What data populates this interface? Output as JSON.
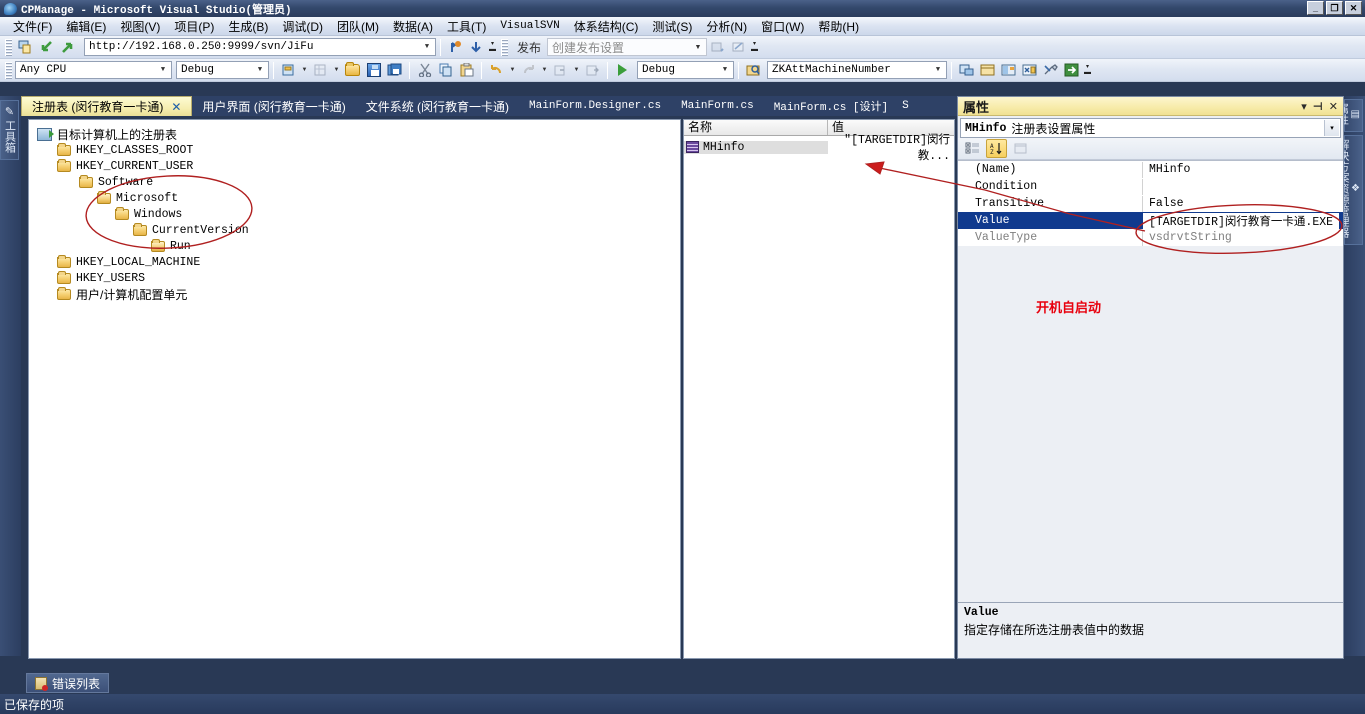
{
  "window": {
    "title": "CPManage - Microsoft Visual Studio(管理员)",
    "minimize": "_",
    "restore": "❐",
    "close": "✕"
  },
  "menu": {
    "items": [
      {
        "label": "文件(F)"
      },
      {
        "label": "编辑(E)"
      },
      {
        "label": "视图(V)"
      },
      {
        "label": "项目(P)"
      },
      {
        "label": "生成(B)"
      },
      {
        "label": "调试(D)"
      },
      {
        "label": "团队(M)"
      },
      {
        "label": "数据(A)"
      },
      {
        "label": "工具(T)"
      },
      {
        "label": "VisualSVN"
      },
      {
        "label": "体系结构(C)"
      },
      {
        "label": "测试(S)"
      },
      {
        "label": "分析(N)"
      },
      {
        "label": "窗口(W)"
      },
      {
        "label": "帮助(H)"
      }
    ]
  },
  "toolbar_svn": {
    "url_value": "http://192.168.0.250:9999/svn/JiFu",
    "publish_label": "发布",
    "publish_combo_placeholder": "创建发布设置"
  },
  "toolbar_standard": {
    "platform_value": "Any CPU",
    "config_value": "Debug",
    "debug_target_value": "Debug",
    "find_combo_value": "ZKAttMachineNumber"
  },
  "tabs": [
    {
      "label": "注册表 (闵行教育一卡通)",
      "active": true,
      "closable": true,
      "close_glyph": "✕"
    },
    {
      "label": "用户界面 (闵行教育一卡通)",
      "active": false
    },
    {
      "label": "文件系统 (闵行教育一卡通)",
      "active": false
    },
    {
      "label": "MainForm.Designer.cs",
      "active": false,
      "mono": true
    },
    {
      "label": "MainForm.cs",
      "active": false,
      "mono": true
    },
    {
      "label": "MainForm.cs [设计]",
      "active": false,
      "mono": true
    },
    {
      "label": "S",
      "active": false,
      "mono": true
    }
  ],
  "left_dock": {
    "items": [
      {
        "label": "工具箱",
        "icon": "wrench-icon"
      }
    ]
  },
  "right_dock": {
    "items": [
      {
        "label": "属性",
        "icon": "properties-icon"
      },
      {
        "label": "解决方案资源管理器",
        "icon": "solution-explorer-icon"
      }
    ]
  },
  "registry_tree": [
    {
      "label": "目标计算机上的注册表",
      "indent": 0,
      "icon": "registry-root-icon",
      "cn": true
    },
    {
      "label": "HKEY_CLASSES_ROOT",
      "indent": 1,
      "icon": "folder-icon"
    },
    {
      "label": "HKEY_CURRENT_USER",
      "indent": 1,
      "icon": "folder-icon"
    },
    {
      "label": "Software",
      "indent": 2,
      "icon": "folder-icon"
    },
    {
      "label": "Microsoft",
      "indent": 3,
      "icon": "folder-open-icon"
    },
    {
      "label": "Windows",
      "indent": 4,
      "icon": "folder-icon"
    },
    {
      "label": "CurrentVersion",
      "indent": 5,
      "icon": "folder-icon"
    },
    {
      "label": "Run",
      "indent": 6,
      "icon": "folder-open-icon"
    },
    {
      "label": "HKEY_LOCAL_MACHINE",
      "indent": 1,
      "icon": "folder-icon"
    },
    {
      "label": "HKEY_USERS",
      "indent": 1,
      "icon": "folder-icon"
    },
    {
      "label": "用户/计算机配置单元",
      "indent": 1,
      "icon": "folder-icon",
      "cn": true
    }
  ],
  "value_list": {
    "columns": [
      "名称",
      "值"
    ],
    "rows": [
      {
        "name": "MHinfo",
        "value": "\"[TARGETDIR]闵行教..."
      }
    ]
  },
  "properties": {
    "title": "属性",
    "title_controls": {
      "dropdown": "▾",
      "dock": "⊣",
      "close": "✕"
    },
    "object_name": "MHinfo",
    "object_type": "注册表设置属性",
    "object_dropdown": "▾",
    "toolbar": {
      "categorized": "⊞",
      "alphabetic": "A↓Z",
      "property_pages": "▤"
    },
    "rows": [
      {
        "key": "(Name)",
        "value": "MHinfo",
        "selected": false,
        "dim": false
      },
      {
        "key": "Condition",
        "value": "",
        "selected": false,
        "dim": false
      },
      {
        "key": "Transitive",
        "value": "False",
        "selected": false,
        "dim": false
      },
      {
        "key": "Value",
        "value": "[TARGETDIR]闵行教育一卡通.EXE",
        "selected": true,
        "dim": false
      },
      {
        "key": "ValueType",
        "value": "vsdrvtString",
        "selected": false,
        "dim": true
      }
    ],
    "description": {
      "title": "Value",
      "text": "指定存储在所选注册表值中的数据"
    }
  },
  "annotations": {
    "startup_note": "开机自启动",
    "ink_color": "#b02020",
    "note_color": "#e8000d"
  },
  "bottom": {
    "error_list_tab": "错误列表",
    "status_text": "已保存的项"
  }
}
